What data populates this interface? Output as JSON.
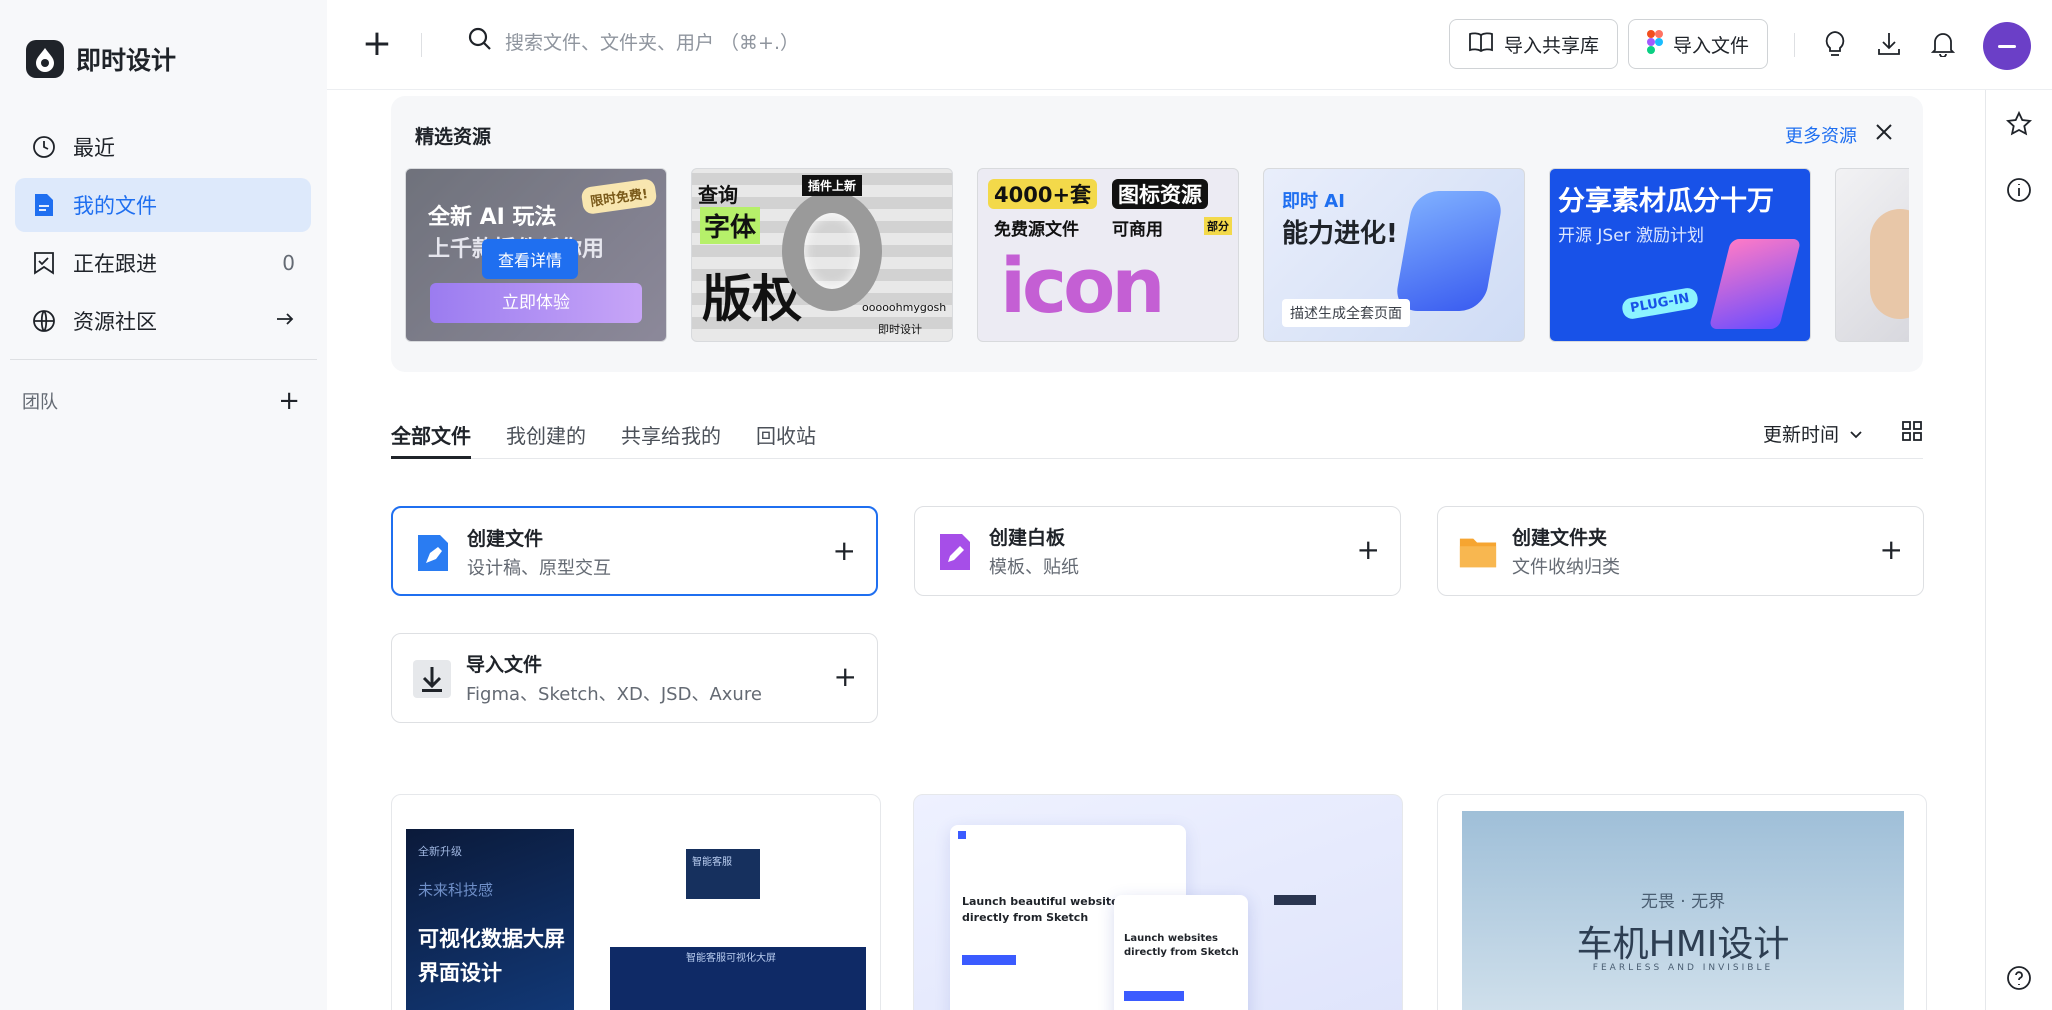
{
  "app": {
    "name": "即时设计"
  },
  "sidebar": {
    "items": [
      {
        "label": "最近",
        "count": ""
      },
      {
        "label": "我的文件",
        "count": ""
      },
      {
        "label": "正在跟进",
        "count": "0"
      },
      {
        "label": "资源社区",
        "count": ""
      }
    ],
    "team_label": "团队",
    "team_add": "+"
  },
  "topbar": {
    "new_symbol": "+",
    "search_placeholder": "搜索文件、文件夹、用户 （⌘+.）",
    "import_library": "导入共享库",
    "import_file": "导入文件"
  },
  "featured": {
    "title": "精选资源",
    "more": "更多资源",
    "cards": [
      {
        "line1": "全新 AI 玩法",
        "line2": "上千款插件任你用",
        "badge": "限时免费!",
        "hover_btn": "查看详情",
        "cta": "立即体验"
      },
      {
        "line1": "查询",
        "line2": "字体",
        "line3": "版权",
        "badge": "插件上新",
        "credit": "ooooohmygosh",
        "brand": "即时设计"
      },
      {
        "line1": "4000+套",
        "line2": "图标资源",
        "tag1": "免费源文件",
        "tag2": "可商用",
        "tag3": "部分",
        "word": "icon"
      },
      {
        "line1": "即时 AI",
        "line2": "能力进化!",
        "caption": "描述生成全套页面"
      },
      {
        "line1": "分享素材瓜分十万",
        "line2": "开源 JSer 激励计划",
        "badge": "PLUG-IN"
      }
    ]
  },
  "tabs": {
    "items": [
      "全部文件",
      "我创建的",
      "共享给我的",
      "回收站"
    ],
    "sort_label": "更新时间"
  },
  "actions": [
    {
      "title": "创建文件",
      "subtitle": "设计稿、原型交互"
    },
    {
      "title": "创建白板",
      "subtitle": "模板、贴纸"
    },
    {
      "title": "创建文件夹",
      "subtitle": "文件收纳归类"
    },
    {
      "title": "导入文件",
      "subtitle": "Figma、Sketch、XD、JSD、Axure"
    }
  ],
  "files": [
    {
      "tag": "全新升级",
      "brand": "未来科技感",
      "title1": "可视化数据大屏",
      "title2": "界面设计",
      "panel1": "智能客服",
      "panel2": "智能客服可视化大屏"
    },
    {
      "headline1": "Launch beautiful websites",
      "headline2": "directly from Sketch",
      "card_headline1": "Launch websites",
      "card_headline2": "directly from Sketch"
    },
    {
      "subtitle": "无畏 · 无界",
      "title": "车机HMI设计",
      "tagline": "FEARLESS AND INVISIBLE"
    }
  ],
  "colors": {
    "accent": "#1f6ff0",
    "active_bg": "#dde9fb",
    "avatar": "#6b3fc7"
  }
}
